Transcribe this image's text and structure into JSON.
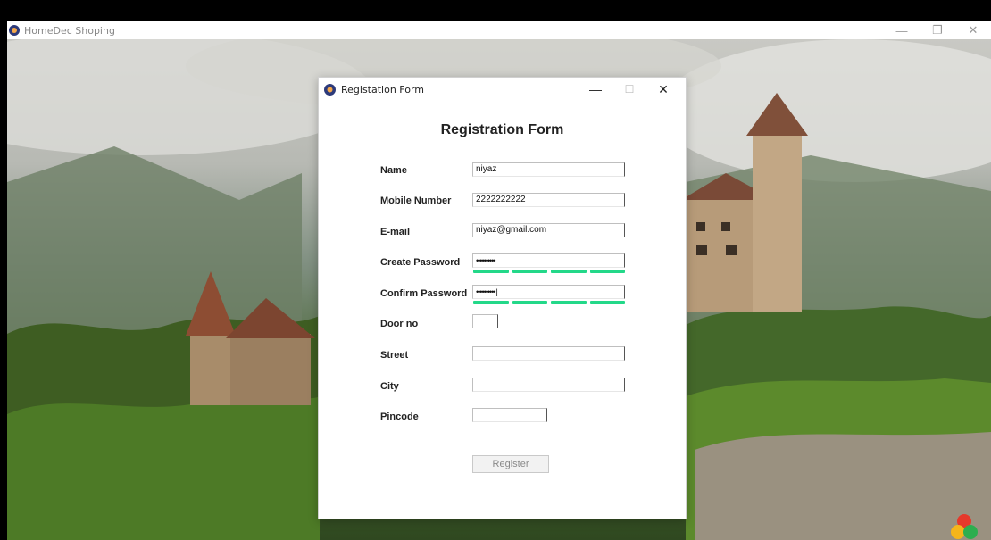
{
  "main_window": {
    "title": "HomeDec Shoping",
    "controls": {
      "minimize": "—",
      "restore": "❐",
      "close": "✕"
    }
  },
  "dialog": {
    "title": "Registation Form",
    "controls": {
      "minimize": "—",
      "maximize": "☐",
      "close": "✕"
    },
    "heading": "Registration Form",
    "fields": {
      "name": {
        "label": "Name",
        "value": "niyaz"
      },
      "mobile": {
        "label": "Mobile Number",
        "value": "2222222222"
      },
      "email": {
        "label": "E-mail",
        "value": "niyaz@gmail.com"
      },
      "create_password": {
        "label": "Create Password",
        "value": "••••••••••"
      },
      "confirm_password": {
        "label": "Confirm Password",
        "value": "••••••••••"
      },
      "door_no": {
        "label": "Door no",
        "value": ""
      },
      "street": {
        "label": "Street",
        "value": ""
      },
      "city": {
        "label": "City",
        "value": ""
      },
      "pincode": {
        "label": "Pincode",
        "value": ""
      }
    },
    "password_strength": {
      "create": 1.0,
      "confirm": 1.0
    },
    "register_label": "Register"
  },
  "icons": {
    "app": "app-logo-icon",
    "text_cursor": "text-cursor-icon",
    "corner": "color-logo-icon"
  },
  "colors": {
    "strength_bar": "#23d889",
    "dialog_bg": "#ffffff",
    "button_text_disabled": "#8a8a8a"
  },
  "cursor_glyph": "I"
}
